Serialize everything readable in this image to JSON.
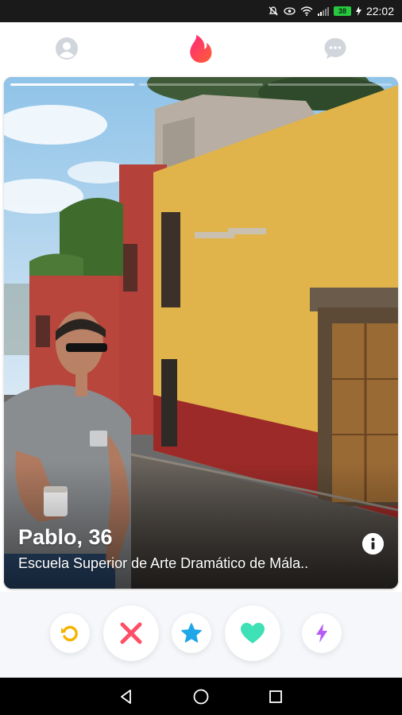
{
  "status_bar": {
    "time": "22:02",
    "battery": "38",
    "icons": [
      "mute-icon",
      "eye-icon",
      "wifi-icon",
      "signal-icon",
      "battery-icon"
    ]
  },
  "top_nav": {
    "icons": [
      "profile-icon",
      "flame-icon",
      "chat-icon"
    ],
    "active": "flame-icon",
    "colors": {
      "inactive": "#d1d5dc",
      "brand": "#fe3c72",
      "brand_gradient_end": "#ff655b"
    }
  },
  "card": {
    "name_age": "Pablo, 36",
    "school": "Escuela Superior de Arte Dramático de Mála..",
    "photo_count": 3,
    "active_photo": 1
  },
  "actions": {
    "buttons": [
      "rewind-icon",
      "nope-icon",
      "super-like-icon",
      "like-icon",
      "boost-icon"
    ],
    "colors": {
      "rewind": "#f5b400",
      "nope": "#fd5068",
      "super_like": "#1ea6e8",
      "like": "#3ee0b5",
      "boost": "#b65bf5"
    }
  },
  "android_nav": {
    "buttons": [
      "back-icon",
      "home-icon",
      "recents-icon"
    ]
  }
}
